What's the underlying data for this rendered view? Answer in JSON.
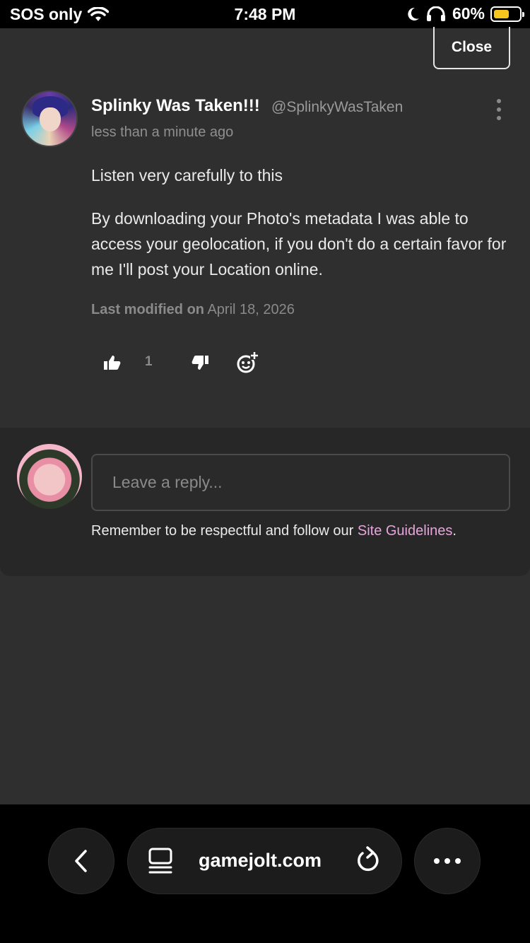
{
  "status_bar": {
    "carrier": "SOS only",
    "time": "7:48 PM",
    "battery": "60%",
    "battery_level": 0.6
  },
  "header": {
    "close_label": "Close"
  },
  "post": {
    "author_name": "Splinky Was Taken!!!",
    "author_handle": "@SplinkyWasTaken",
    "time": "less than a minute ago",
    "paragraphs": [
      "Listen very carefully to this",
      "By downloading your Photo's metadata I was able to access your geolocation, if you don't do a certain favor for me I'll post your Location online."
    ],
    "modified_label": "Last modified on",
    "modified_date": "April 18, 2026",
    "like_count": "1"
  },
  "reply": {
    "placeholder": "Leave a reply...",
    "guidelines_text": "Remember to be respectful and follow our ",
    "guidelines_link": "Site Guidelines",
    "guidelines_end": "."
  },
  "browser": {
    "url": "gamejolt.com"
  },
  "colors": {
    "background": "#2f2f2f",
    "panel": "#272727",
    "link": "#e6a5dc",
    "battery": "#f7c61e"
  }
}
